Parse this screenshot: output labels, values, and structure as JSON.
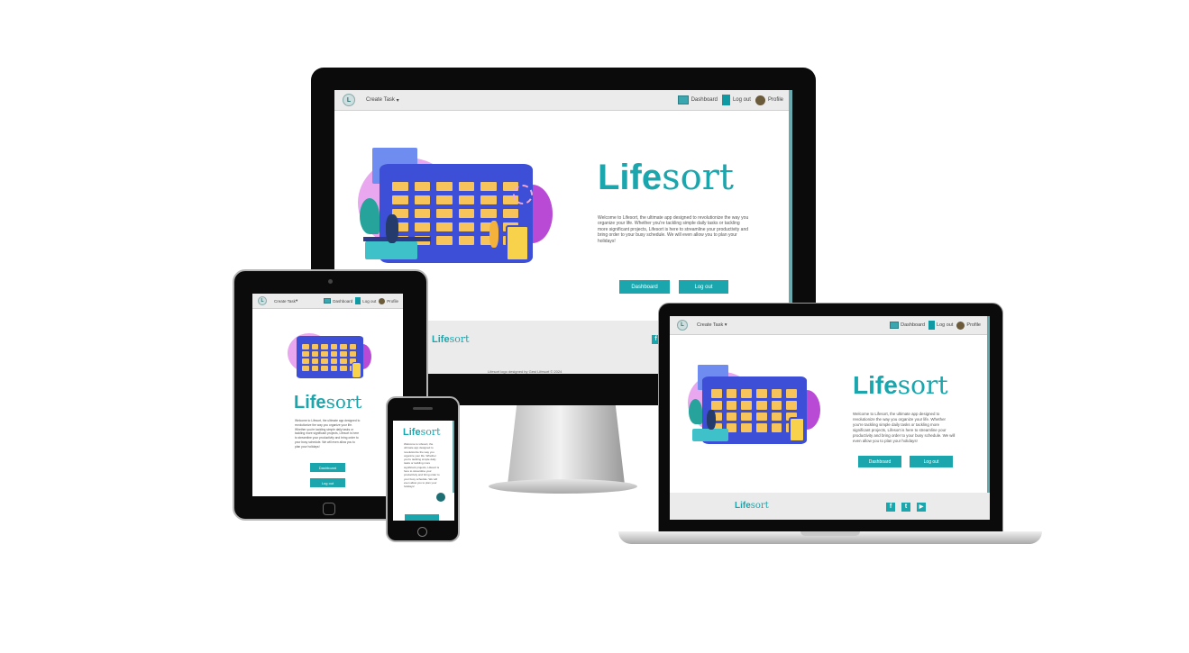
{
  "app": {
    "brand_bold": "Life",
    "brand_light": "sort",
    "nav": {
      "logo_letter": "L",
      "create_task": "Create Task",
      "create_task_caret": "▾",
      "dashboard": "Dashboard",
      "logout": "Log out",
      "profile": "Profile"
    },
    "intro_full": "Welcome to Lifesort, the ultimate app designed to revolutionize the way you organize your life. Whether you're tackling simple daily tasks or tackling more significant projects, Lifesort is here to streamline your productivity and bring order to your busy schedule. We will even allow you to plan your holidays!",
    "buttons": {
      "dashboard": "Dashboard",
      "logout": "Log out"
    },
    "footer": {
      "copyright": "Lifesort logo designed by Gest Lifesort © 2024",
      "social": [
        "f",
        "t",
        "▶"
      ]
    }
  },
  "colors": {
    "accent": "#1ba6ad",
    "nav_bg": "#ebebeb",
    "device_black": "#0b0b0b"
  },
  "icons": {
    "dashboard": "dashboard-icon",
    "logout": "logout-icon",
    "profile": "profile-avatar-icon",
    "facebook": "facebook-icon",
    "twitter": "twitter-icon",
    "youtube": "youtube-icon"
  }
}
